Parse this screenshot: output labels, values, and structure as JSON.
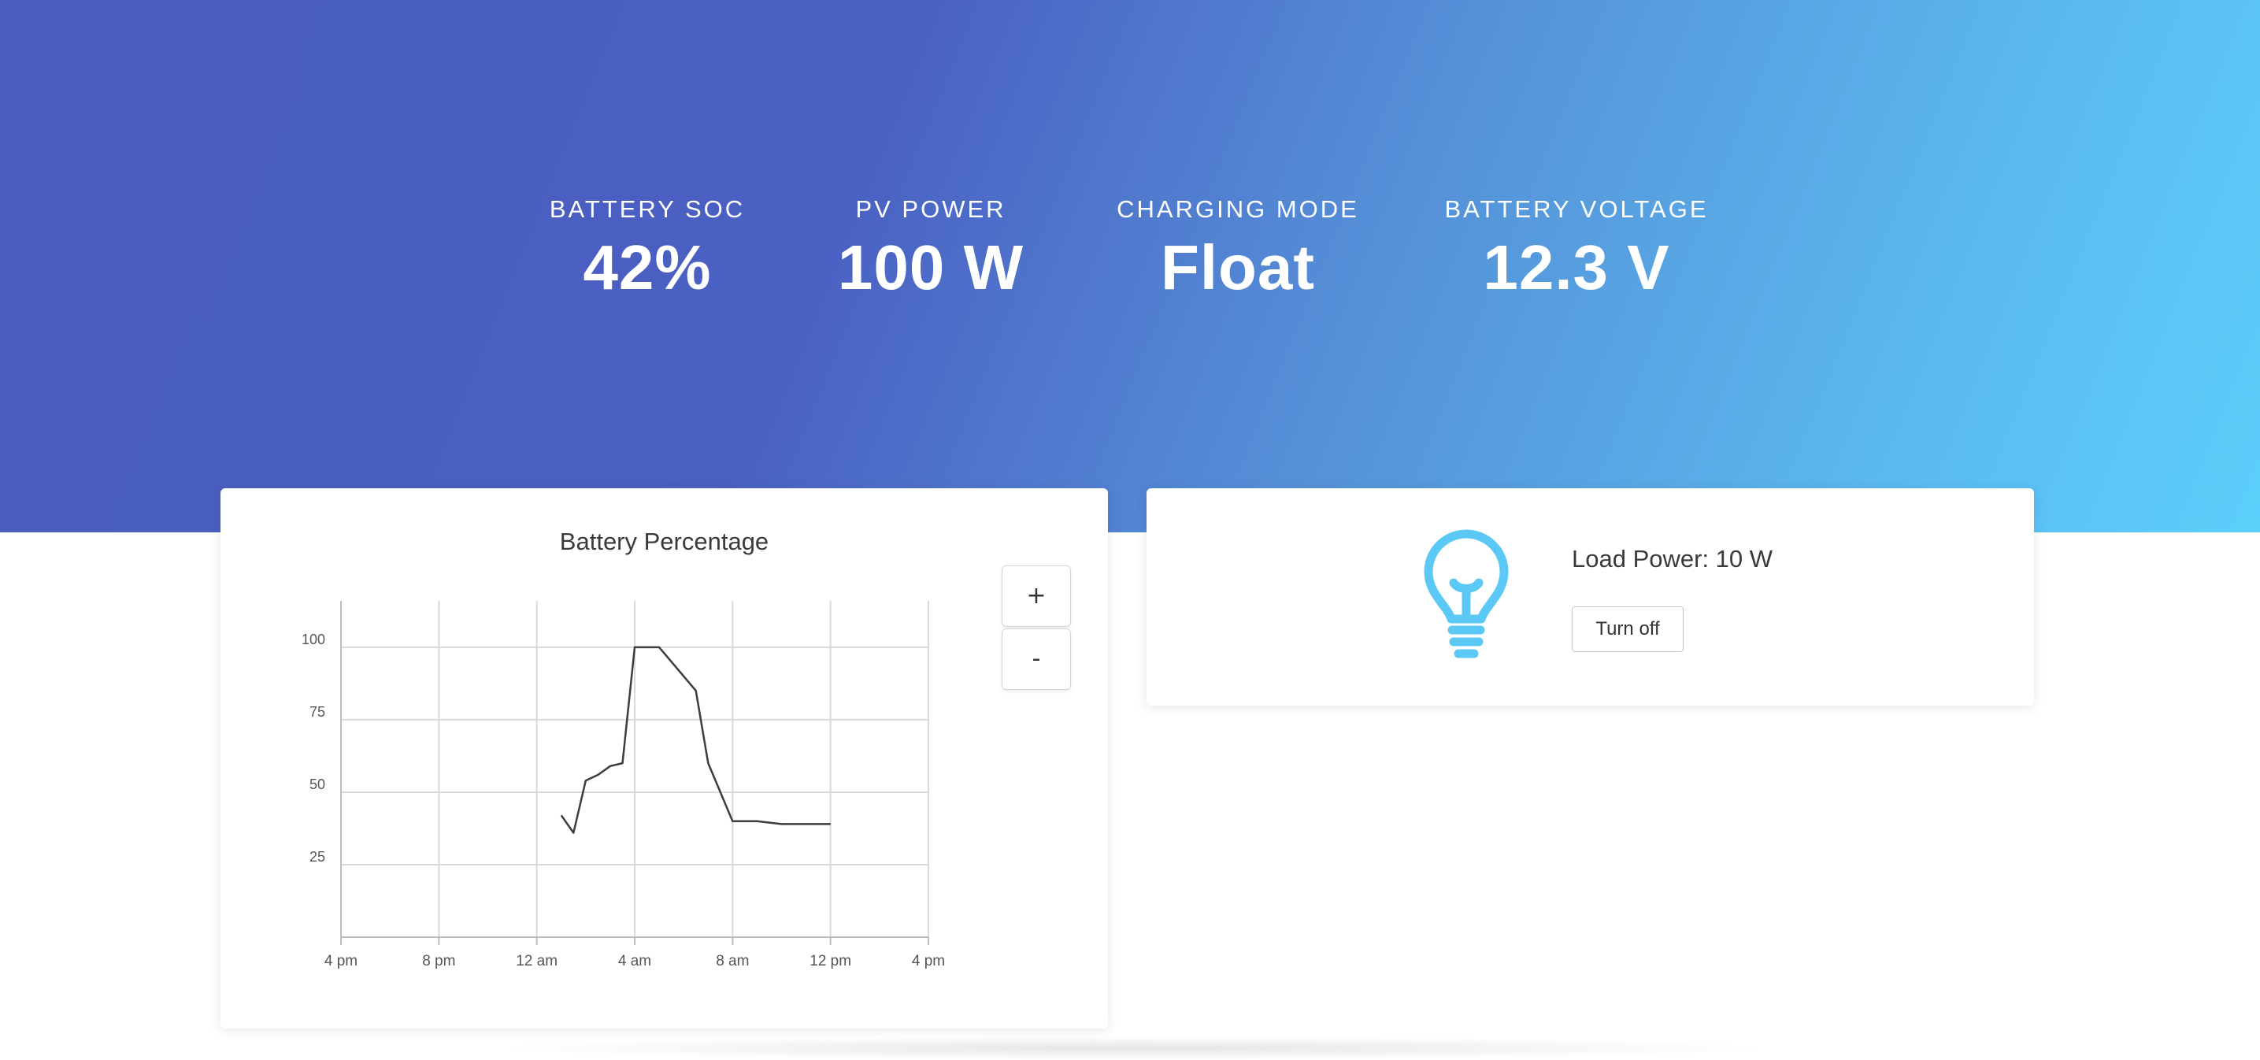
{
  "stats": [
    {
      "label": "BATTERY SOC",
      "value": "42%"
    },
    {
      "label": "PV POWER",
      "value": "100 W"
    },
    {
      "label": "CHARGING MODE",
      "value": "Float"
    },
    {
      "label": "BATTERY VOLTAGE",
      "value": "12.3 V"
    }
  ],
  "chart_card": {
    "zoom_in_label": "+",
    "zoom_out_label": "-"
  },
  "chart_data": {
    "type": "line",
    "title": "Battery Percentage",
    "xlabel": "",
    "ylabel": "",
    "x_ticks": [
      "4 pm",
      "8 pm",
      "12 am",
      "4 am",
      "8 am",
      "12 pm",
      "4 pm"
    ],
    "y_ticks": [
      100,
      75,
      50,
      25
    ],
    "xlim_hours": [
      0,
      24
    ],
    "ylim": [
      0,
      116
    ],
    "grid": true,
    "series": [
      {
        "x": [
          9.0,
          9.5,
          10.0,
          10.5,
          11.0,
          11.5,
          12.0,
          13.0,
          14.0,
          14.5,
          15.0,
          15.5,
          16.0,
          17.0,
          18.0,
          18.5,
          20.0
        ],
        "y": [
          42,
          36,
          54,
          56,
          59,
          60,
          100,
          100,
          90,
          85,
          60,
          50,
          40,
          40,
          39,
          39,
          39
        ]
      }
    ],
    "color": "#3d3d3d"
  },
  "load_card": {
    "label": "Load Power: 10 W",
    "button_label": "Turn off",
    "icon": "lightbulb-icon",
    "icon_color": "#5bc8f5"
  },
  "colors": {
    "hero_start": "#4a5cbd",
    "hero_end": "#5ccffb",
    "text_light": "#ffffff"
  }
}
